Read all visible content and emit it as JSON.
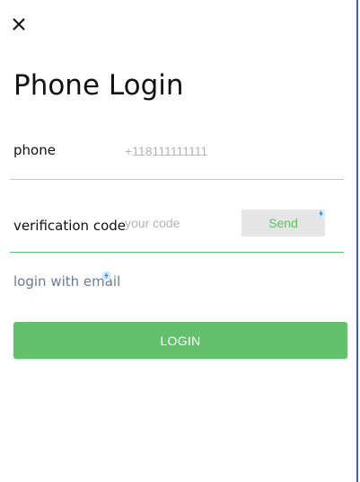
{
  "header": {
    "close_icon": "close-icon",
    "title": "Phone Login"
  },
  "form": {
    "phone_label": "phone",
    "phone_placeholder": "+118111111111",
    "code_label": "verification code",
    "code_placeholder": "your code",
    "send_label": "Send",
    "badge_icon": "lightning-icon"
  },
  "links": {
    "email_login": "login with email"
  },
  "actions": {
    "login_label": "LOGIN"
  },
  "colors": {
    "accent": "#64c06d",
    "send_text": "#5cbf6a",
    "link": "#6b7a93",
    "border": "#3a5bd9"
  }
}
